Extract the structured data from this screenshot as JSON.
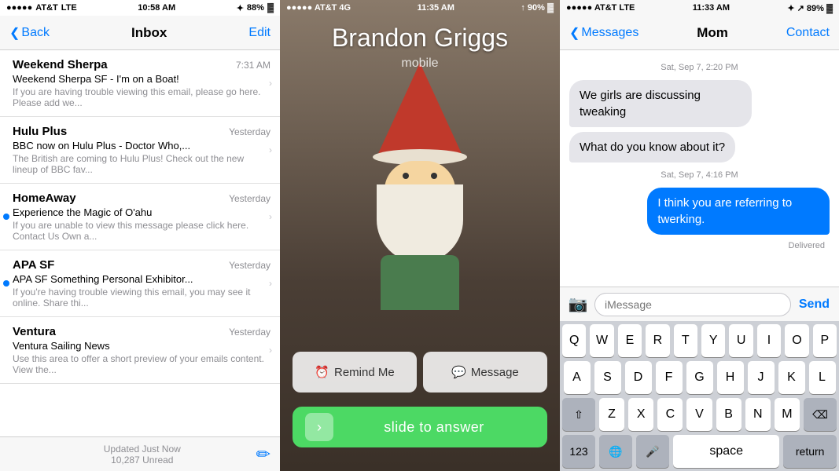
{
  "email_panel": {
    "status_bar": {
      "carrier": "AT&T",
      "network": "LTE",
      "time": "10:58 AM",
      "battery": "88%"
    },
    "nav": {
      "back": "Back",
      "title": "Inbox",
      "edit": "Edit"
    },
    "emails": [
      {
        "sender": "Weekend Sherpa",
        "time": "7:31 AM",
        "subject": "Weekend Sherpa SF - I'm on a Boat!",
        "preview": "If you are having trouble viewing this email, please go here. Please add we...",
        "unread": false
      },
      {
        "sender": "Hulu Plus",
        "time": "Yesterday",
        "subject": "BBC now on Hulu Plus - Doctor Who,...",
        "preview": "The British are coming to Hulu Plus! Check out the new lineup of BBC fav...",
        "unread": false
      },
      {
        "sender": "HomeAway",
        "time": "Yesterday",
        "subject": "Experience the Magic of O'ahu",
        "preview": "If you are unable to view this message please click here. Contact Us Own a...",
        "unread": true
      },
      {
        "sender": "APA SF",
        "time": "Yesterday",
        "subject": "APA SF Something Personal Exhibitor...",
        "preview": "If you're having trouble viewing this email, you may see it online. Share thi...",
        "unread": true
      },
      {
        "sender": "Ventura",
        "time": "Yesterday",
        "subject": "Ventura Sailing News",
        "preview": "Use this area to offer a short preview of your emails content. View the...",
        "unread": false
      }
    ],
    "footer": {
      "updated": "Updated Just Now",
      "unread_count": "10,287 Unread"
    }
  },
  "call_panel": {
    "status_bar": {
      "carrier": "AT&T",
      "network": "4G",
      "time": "11:35 AM",
      "battery": "90%"
    },
    "caller_name": "Brandon Griggs",
    "caller_type": "mobile",
    "remind_me": "Remind Me",
    "message": "Message",
    "slide_to_answer": "slide to answer"
  },
  "messages_panel": {
    "status_bar": {
      "carrier": "AT&T",
      "network": "LTE",
      "time": "11:33 AM",
      "battery": "89%"
    },
    "nav": {
      "back": "Messages",
      "title": "Mom",
      "contact": "Contact"
    },
    "date_label_1": "Sat, Sep 7, 2:20 PM",
    "messages": [
      {
        "type": "incoming",
        "text": "We girls are discussing tweaking"
      },
      {
        "type": "incoming",
        "text": "What do you know about it?"
      }
    ],
    "date_label_2": "Sat, Sep 7, 4:16 PM",
    "outgoing_message": "I think you are referring to twerking.",
    "delivered": "Delivered",
    "input_placeholder": "iMessage",
    "send_label": "Send",
    "keyboard": {
      "row1": [
        "Q",
        "W",
        "E",
        "R",
        "T",
        "Y",
        "U",
        "I",
        "O",
        "P"
      ],
      "row2": [
        "A",
        "S",
        "D",
        "F",
        "G",
        "H",
        "J",
        "K",
        "L"
      ],
      "row3": [
        "Z",
        "X",
        "C",
        "V",
        "B",
        "N",
        "M"
      ],
      "bottom_left": "123",
      "bottom_space": "space",
      "bottom_right": "return"
    }
  }
}
